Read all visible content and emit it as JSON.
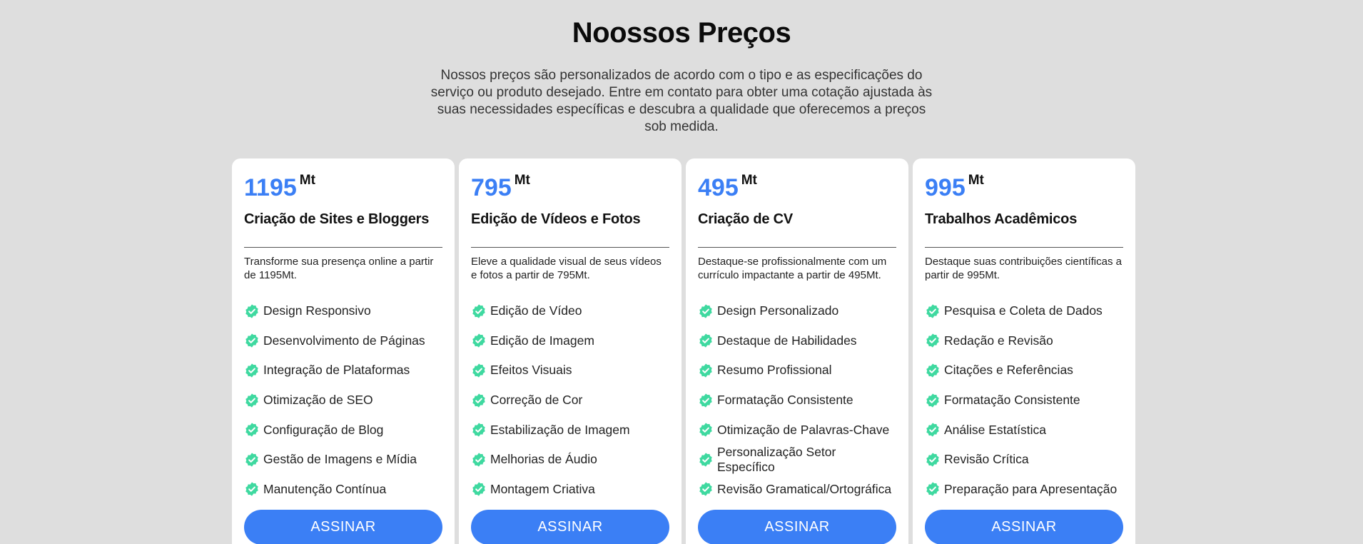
{
  "section": {
    "title": "Noossos Preços",
    "intro": "Nossos preços são personalizados de acordo com o tipo e as especificações do serviço ou produto desejado. Entre em contato para obter uma cotação ajustada às suas necessidades específicas e descubra a qualidade que oferecemos a preços sob medida."
  },
  "colors": {
    "accent": "#3b7ff5",
    "check": "#3fd9a0",
    "background": "#dedede"
  },
  "plans": [
    {
      "price": "1195",
      "currency": "Mt",
      "title": "Criação de Sites e Bloggers",
      "description": "Transforme sua presença online a partir de 1195Mt.",
      "features": [
        "Design Responsivo",
        "Desenvolvimento de Páginas",
        "Integração de Plataformas",
        "Otimização de SEO",
        "Configuração de Blog",
        "Gestão de Imagens e Mídia",
        "Manutenção Contínua"
      ],
      "button": "ASSINAR"
    },
    {
      "price": "795",
      "currency": "Mt",
      "title": "Edição de Vídeos e Fotos",
      "description": "Eleve a qualidade visual de seus vídeos e fotos a partir de 795Mt.",
      "features": [
        "Edição de Vídeo",
        "Edição de Imagem",
        "Efeitos Visuais",
        "Correção de Cor",
        "Estabilização de Imagem",
        "Melhorias de Áudio",
        "Montagem Criativa"
      ],
      "button": "ASSINAR"
    },
    {
      "price": "495",
      "currency": "Mt",
      "title": "Criação de CV",
      "description": "Destaque-se profissionalmente com um currículo impactante a partir de 495Mt.",
      "features": [
        "Design Personalizado",
        "Destaque de Habilidades",
        "Resumo Profissional",
        "Formatação Consistente",
        "Otimização de Palavras-Chave",
        "Personalização Setor Específico",
        "Revisão Gramatical/Ortográfica"
      ],
      "button": "ASSINAR"
    },
    {
      "price": "995",
      "currency": "Mt",
      "title": "Trabalhos Acadêmicos",
      "description": "Destaque suas contribuições científicas a partir de 995Mt.",
      "features": [
        "Pesquisa e Coleta de Dados",
        "Redação e Revisão",
        "Citações e Referências",
        "Formatação Consistente",
        "Análise Estatística",
        "Revisão Crítica",
        "Preparação para Apresentação"
      ],
      "button": "ASSINAR"
    }
  ]
}
